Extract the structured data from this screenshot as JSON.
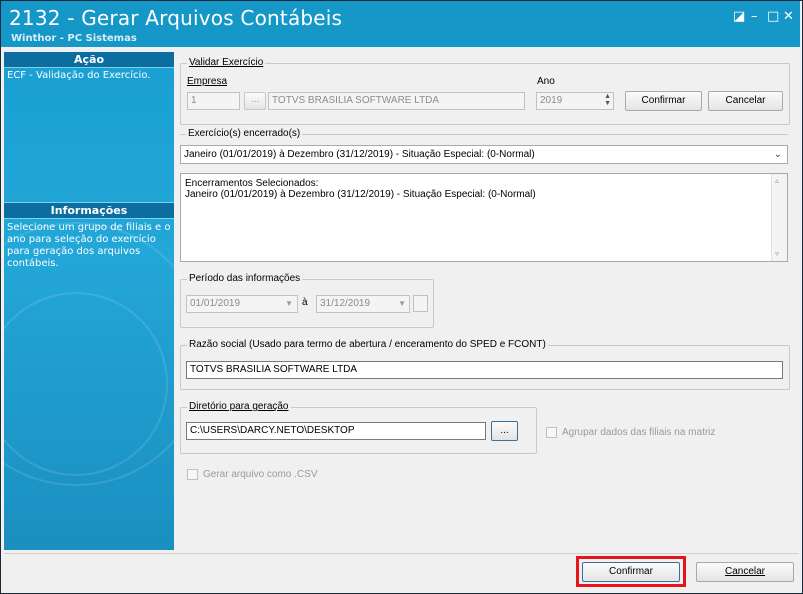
{
  "window": {
    "title": "2132 - Gerar Arquivos Contábeis",
    "subtitle": "Winthor - PC Sistemas",
    "title_bg": "#1597c8"
  },
  "window_controls": {
    "restore": "◪",
    "minimize": "–",
    "maximize": "□",
    "close": "✕"
  },
  "sidebar": {
    "acao_header": "Ação",
    "acao_text": "ECF - Validação do Exercício.",
    "info_header": "Informações",
    "info_text": "Selecione um grupo de filiais e o ano para seleção do exercício para geração dos arquivos contábeis."
  },
  "validar": {
    "legend": "Validar Exercício",
    "empresa_label": "Empresa",
    "empresa_code": "1",
    "empresa_lookup": "...",
    "empresa_name": "TOTVS BRASILIA SOFTWARE LTDA",
    "ano_label": "Ano",
    "ano_value": "2019",
    "confirmar": "Confirmar",
    "cancelar": "Cancelar"
  },
  "exercicios": {
    "legend": "Exercício(s) encerrado(s)",
    "selected": "Janeiro (01/01/2019) à Dezembro (31/12/2019) - Situação Especial:  (0-Normal)",
    "memo_title": "Encerramentos Selecionados:",
    "memo_line": "Janeiro (01/01/2019) à Dezembro (31/12/2019) - Situação Especial:  (0-Normal)"
  },
  "periodo": {
    "legend": "Período das informações",
    "inicio": "01/01/2019",
    "separator": "à",
    "fim": "31/12/2019"
  },
  "razao": {
    "legend": "Razão social (Usado para termo de abertura / enceramento do SPED e FCONT)",
    "value": "TOTVS BRASILIA SOFTWARE LTDA"
  },
  "diretorio": {
    "legend": "Diretório para geração",
    "value": "C:\\USERS\\DARCY.NETO\\DESKTOP",
    "browse": "...",
    "agrupar_label": "Agrupar dados das filiais na matriz"
  },
  "csv_label": "Gerar arquivo como .CSV",
  "footer": {
    "confirmar": "Confirmar",
    "cancelar": "Cancelar",
    "highlight_color": "#e8141c"
  }
}
